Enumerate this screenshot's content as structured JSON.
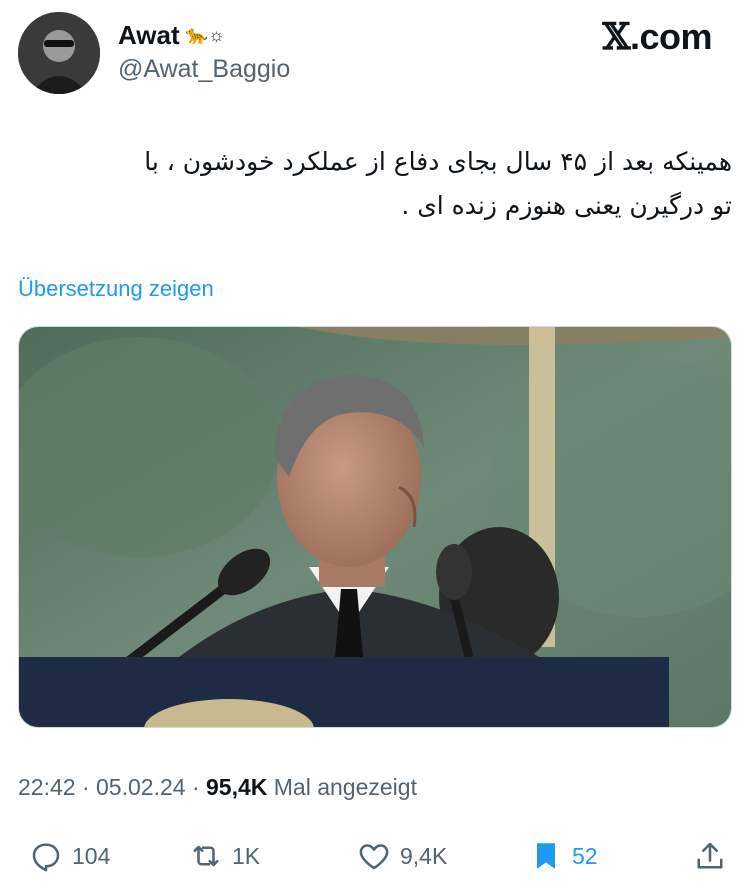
{
  "author": {
    "display_name": "Awat",
    "name_decoration": "🐆☼",
    "handle": "@Awat_Baggio"
  },
  "brand": {
    "prefix": "𝕏",
    "suffix": ".com"
  },
  "tweet": {
    "text_line1": "همینکه بعد از ۴۵ سال بجای دفاع از عملکرد خودشون ، با",
    "text_line2": "تو درگیرن یعنی هنوزم زنده ای ."
  },
  "translate_label": "Übersetzung zeigen",
  "meta": {
    "time": "22:42",
    "date": "05.02.24",
    "views": "95,4K",
    "views_label": "Mal angezeigt",
    "separator": "·"
  },
  "actions": {
    "replies": "104",
    "retweets": "1K",
    "likes": "9,4K",
    "bookmarks": "52"
  },
  "colors": {
    "accent": "#1d9bf0",
    "secondary_text": "#536471",
    "primary_text": "#0f1419"
  }
}
